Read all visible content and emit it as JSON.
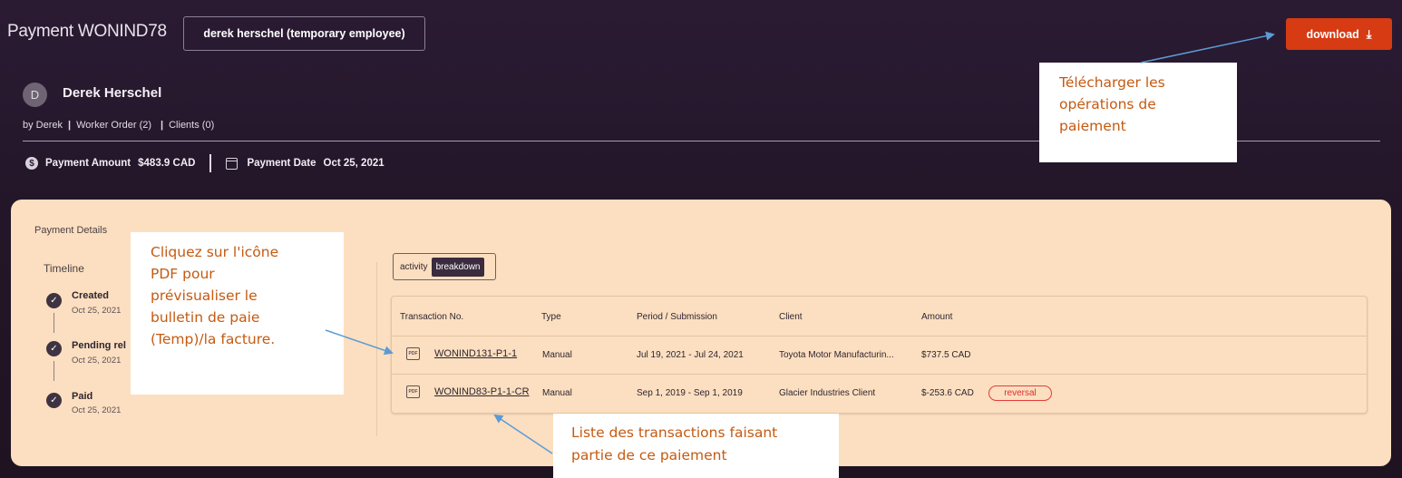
{
  "header": {
    "title": "Payment WONIND78",
    "worker_chip": "derek herschel (temporary employee)",
    "download_label": "download",
    "download_icon": "download-arrow-icon"
  },
  "worker": {
    "avatar_initial": "D",
    "name": "Derek Herschel",
    "by": "by Derek",
    "worker_order": "Worker Order (2)",
    "clients": "Clients (0)"
  },
  "payment_summary": {
    "amount_label": "Payment Amount",
    "amount_value": "$483.9 CAD",
    "date_label": "Payment Date",
    "date_value": "Oct 25, 2021"
  },
  "panel": {
    "title": "Payment Details",
    "timeline_title": "Timeline",
    "timeline": [
      {
        "label": "Created",
        "date": "Oct 25, 2021"
      },
      {
        "label": "Pending rel",
        "date": "Oct 25, 2021"
      },
      {
        "label": "Paid",
        "date": "Oct 25, 2021"
      }
    ],
    "toggle": {
      "activity": "activity",
      "breakdown": "breakdown"
    }
  },
  "table": {
    "headers": [
      "Transaction No.",
      "Type",
      "Period / Submission",
      "Client",
      "Amount"
    ],
    "rows": [
      {
        "txn": "WONIND131-P1-1",
        "type": "Manual",
        "period": "Jul 19, 2021 - Jul 24, 2021",
        "client": "Toyota Motor Manufacturin...",
        "amount": "$737.5 CAD",
        "badge": ""
      },
      {
        "txn": "WONIND83-P1-1-CR",
        "type": "Manual",
        "period": "Sep 1, 2019 - Sep 1, 2019",
        "client": "Glacier Industries Client",
        "amount": "$-253.6 CAD",
        "badge": "reversal"
      }
    ],
    "pdf_icon_label": "PDF"
  },
  "callouts": {
    "download": [
      "Télécharger les",
      "opérations de",
      "paiement"
    ],
    "pdf": [
      "Cliquez sur l'icône",
      "PDF pour",
      "prévisualiser le",
      "bulletin de paie",
      "(Temp)/la facture."
    ],
    "list": [
      "Liste des transactions faisant",
      "partie de ce paiement"
    ]
  },
  "colors": {
    "accent": "#d63b14",
    "callout_text": "#c55a11",
    "panel_bg": "#fcdfc0",
    "reversal": "#e53b3b",
    "arrow": "#5b9bd5"
  }
}
